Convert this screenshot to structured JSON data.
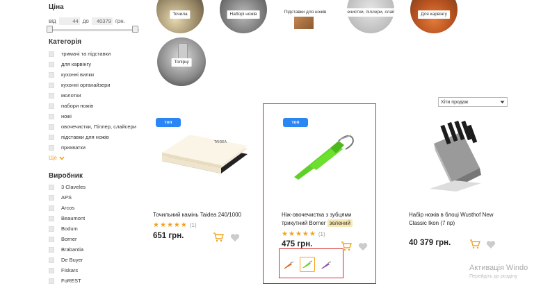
{
  "filters": {
    "price_title": "Ціна",
    "price_from_label": "від",
    "price_from": "44",
    "price_to_label": "до",
    "price_to": "40379",
    "currency": "грн.",
    "category_title": "Категорія",
    "categories": [
      "тримачі та підставки",
      "для карвінгу",
      "кухонні вилки",
      "кухонні органайзери",
      "молотки",
      "набори ножів",
      "ножі",
      "овочечистки, Пiллер, слайсери",
      "підставки для ножів",
      "прихватки"
    ],
    "more_label": "Ще",
    "maker_title": "Виробник",
    "makers": [
      "3 Claveles",
      "APS",
      "Arcos",
      "Beaumont",
      "Bodum",
      "Borner",
      "Brabantia",
      "De Buyer",
      "Fiskars",
      "FoREST"
    ]
  },
  "category_circles": [
    {
      "label": "Точила"
    },
    {
      "label": "Наборі ножів"
    },
    {
      "label": "Підставки для ножів"
    },
    {
      "label": "Овочечистки, пiллери, слайсери"
    },
    {
      "label": "Для карвінгу"
    },
    {
      "label": "Топірці"
    }
  ],
  "sort": {
    "value": "Хіти продаж"
  },
  "products": [
    {
      "badge": "топ",
      "name": "Точильний камінь Taidea 240/1000",
      "rating_count": "(1)",
      "price": "651 грн."
    },
    {
      "badge": "топ",
      "name_line1": "Ніж-овочечистка з зубцями",
      "name_line2": "трикутний Borner",
      "color_tag": "зелений",
      "rating_count": "(1)",
      "price": "475 грн."
    },
    {
      "name_line1": "Набір ножів в блоці Wusthof New",
      "name_line2": "Classic Ikon (7 пр)",
      "price": "40 379 грн."
    }
  ],
  "watermark": {
    "title": "Активація Windo",
    "sub": "Перейдіть до розділу"
  },
  "colors": {
    "accent": "#f4a21c",
    "badge": "#2a86f5",
    "highlight": "#d32a2a",
    "swatch_orange": "#e8661c",
    "swatch_green": "#5fd126",
    "swatch_purple": "#8a4fb8"
  }
}
